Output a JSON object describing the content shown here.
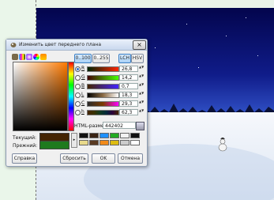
{
  "dialog": {
    "title": "Изменить цвет переднего плана",
    "close_glyph": "×",
    "toolbar_icons": [
      "gimp-icon",
      "cmyk-icon",
      "watercolor-icon",
      "wheel-icon",
      "palette-icon"
    ],
    "range_buttons": [
      "0..100",
      "0..255"
    ],
    "mode_buttons": [
      "LCH",
      "HSV"
    ],
    "channels": [
      {
        "label": "R",
        "value": "26,8",
        "selected": true
      },
      {
        "label": "G",
        "value": "14,2",
        "selected": false
      },
      {
        "label": "B",
        "value": "0,7",
        "selected": false
      },
      {
        "label": "L",
        "value": "18,3",
        "selected": false
      },
      {
        "label": "C",
        "value": "29,3",
        "selected": false
      },
      {
        "label": "h",
        "value": "62,3",
        "selected": false
      }
    ],
    "html_label": "HTML-разметка:",
    "html_value": "442402",
    "current_label": "Текущий:",
    "previous_label": "Прежний:",
    "arrow_glyph": "▸",
    "buttons": {
      "help": "Справка",
      "reset": "Сбросить",
      "ok": "OK",
      "cancel": "Отмена"
    },
    "colors": {
      "current": "#442402",
      "previous": "#1e7a1e",
      "accent": "#3c7fc4"
    },
    "palette": [
      "#111111",
      "#3a2414",
      "#1e90ff",
      "#22aa22",
      "#f2f2f2",
      "#111111",
      "#e8d98a",
      "#5a3a22",
      "#f08a1a",
      "#ddbb11",
      "#cccccc",
      "#ffffff"
    ]
  },
  "icons": {
    "spin": "▲▼"
  }
}
